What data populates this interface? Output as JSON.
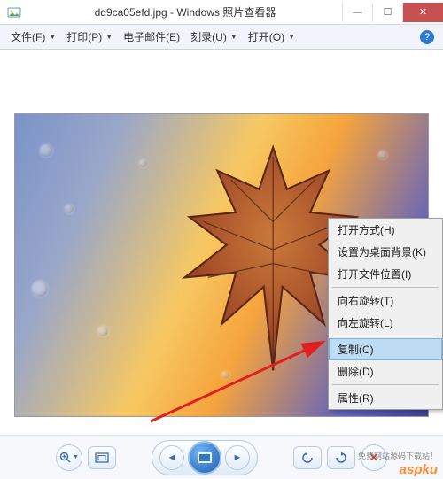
{
  "titlebar": {
    "title": "dd9ca05efd.jpg - Windows 照片查看器"
  },
  "menubar": {
    "file": "文件(F)",
    "print": "打印(P)",
    "email": "电子邮件(E)",
    "burn": "刻录(U)",
    "open": "打开(O)"
  },
  "contextmenu": {
    "open_with": "打开方式(H)",
    "set_wallpaper": "设置为桌面背景(K)",
    "open_location": "打开文件位置(I)",
    "rotate_right": "向右旋转(T)",
    "rotate_left": "向左旋转(L)",
    "copy": "复制(C)",
    "delete": "删除(D)",
    "properties": "属性(R)"
  },
  "watermark": {
    "main": "aspku",
    "sub": "免费网站源码下载站！"
  }
}
